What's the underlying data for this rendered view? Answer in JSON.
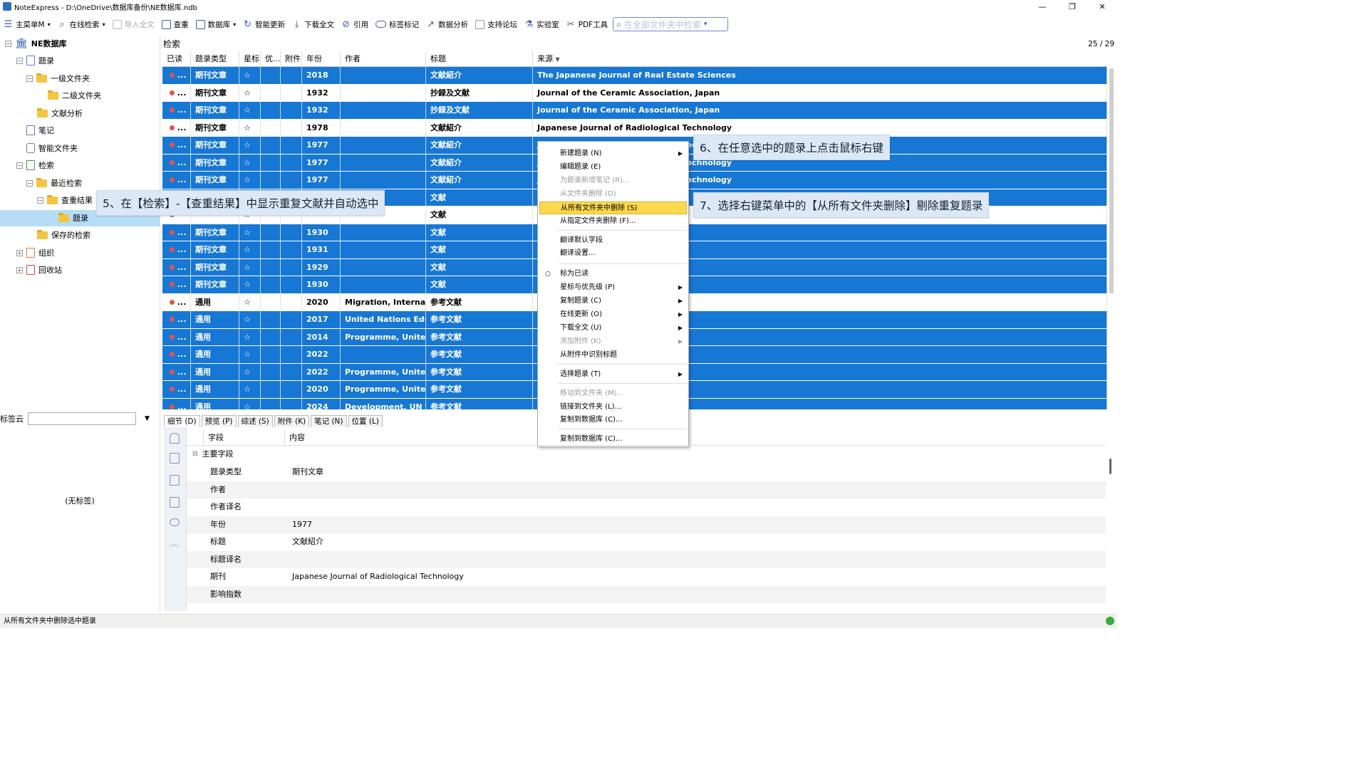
{
  "window": {
    "title": "NoteExpress - D:\\OneDrive\\数据库备份\\NE数据库.ndb",
    "minimize": "—",
    "maximize": "❐",
    "close": "✕"
  },
  "toolbar": {
    "items": [
      {
        "label": "主菜单M",
        "icon": "menu-icon",
        "dropdown": true
      },
      {
        "label": "在线检索",
        "icon": "search-icon",
        "dropdown": true
      },
      {
        "label": "导入全文",
        "icon": "import-icon",
        "disabled": true
      },
      {
        "label": "查重",
        "icon": "duplicate-icon"
      },
      {
        "label": "数据库",
        "icon": "database-icon",
        "dropdown": true
      },
      {
        "label": "智能更新",
        "icon": "refresh-icon"
      },
      {
        "label": "下载全文",
        "icon": "download-icon"
      },
      {
        "label": "引用",
        "icon": "cite-icon"
      },
      {
        "label": "标签标记",
        "icon": "tag-icon"
      },
      {
        "label": "数据分析",
        "icon": "chart-icon"
      },
      {
        "label": "支持论坛",
        "icon": "forum-icon"
      },
      {
        "label": "实验室",
        "icon": "lab-icon"
      },
      {
        "label": "PDF工具",
        "icon": "pdf-tool-icon"
      }
    ],
    "search_placeholder": "在全部文件夹中检索"
  },
  "tree": {
    "root": "NE数据库",
    "items": [
      {
        "label": "题录"
      },
      {
        "label": "一级文件夹"
      },
      {
        "label": "二级文件夹"
      },
      {
        "label": "文献分析"
      },
      {
        "label": "笔记"
      },
      {
        "label": "智能文件夹"
      },
      {
        "label": "检索"
      },
      {
        "label": "最近检索"
      },
      {
        "label": "查重结果"
      },
      {
        "label": "题录"
      },
      {
        "label": "保存的检索"
      },
      {
        "label": "组织"
      },
      {
        "label": "回收站"
      }
    ]
  },
  "main": {
    "heading": "检索",
    "page_counter": "25 / 29",
    "columns": [
      "已读",
      "题录类型",
      "星标",
      "优...",
      "附件",
      "年份",
      "作者",
      "标题",
      "来源"
    ],
    "rows": [
      {
        "sel": true,
        "more": "...",
        "type": "期刊文章",
        "year": "2018",
        "author": "",
        "title": "文献紹介",
        "source": "The Japanese Journal of Real Estate Sciences"
      },
      {
        "sel": false,
        "more": "...",
        "type": "期刊文章",
        "year": "1932",
        "author": "",
        "title": "抄録及文献",
        "source": "Journal of the Ceramic Association, Japan"
      },
      {
        "sel": true,
        "more": "...",
        "type": "期刊文章",
        "year": "1932",
        "author": "",
        "title": "抄録及文献",
        "source": "Journal of the Ceramic Association, Japan"
      },
      {
        "sel": false,
        "more": "...",
        "type": "期刊文章",
        "year": "1978",
        "author": "",
        "title": "文献紹介",
        "source": "Japanese Journal of Radiological Technology"
      },
      {
        "sel": true,
        "more": "...",
        "type": "期刊文章",
        "year": "1977",
        "author": "",
        "title": "文献紹介",
        "source": "Japanese Journal of Radiological Technology"
      },
      {
        "sel": true,
        "more": "...",
        "type": "期刊文章",
        "year": "1977",
        "author": "",
        "title": "文献紹介",
        "source": "Japanese Journal of Radiological Technology"
      },
      {
        "sel": true,
        "more": "...",
        "type": "期刊文章",
        "year": "1977",
        "author": "",
        "title": "文献紹介",
        "source": "Japanese Journal of Radiological Technology"
      },
      {
        "sel": true,
        "more": "",
        "type": "",
        "year": "",
        "author": "",
        "title": "文献",
        "source": ""
      },
      {
        "sel": false,
        "more": "",
        "type": "",
        "year": "",
        "author": "",
        "title": "文献",
        "source": ""
      },
      {
        "sel": true,
        "more": "...",
        "type": "期刊文章",
        "year": "1930",
        "author": "",
        "title": "文献",
        "source": ""
      },
      {
        "sel": true,
        "more": "...",
        "type": "期刊文章",
        "year": "1931",
        "author": "",
        "title": "文献",
        "source": ""
      },
      {
        "sel": true,
        "more": "...",
        "type": "期刊文章",
        "year": "1929",
        "author": "",
        "title": "文献",
        "source": ""
      },
      {
        "sel": true,
        "more": "...",
        "type": "期刊文章",
        "year": "1930",
        "author": "",
        "title": "文献",
        "source": ""
      },
      {
        "sel": false,
        "more": "...",
        "type": "通用",
        "year": "2020",
        "author": "Migration, Internati",
        "title": "参考文献",
        "source": ""
      },
      {
        "sel": true,
        "more": "...",
        "type": "通用",
        "year": "2017",
        "author": "United Nations Edu.",
        "title": "参考文献",
        "source": ""
      },
      {
        "sel": true,
        "more": "...",
        "type": "通用",
        "year": "2014",
        "author": "Programme, United",
        "title": "参考文献",
        "source": ""
      },
      {
        "sel": true,
        "more": "...",
        "type": "通用",
        "year": "2022",
        "author": "",
        "title": "参考文献",
        "source": ""
      },
      {
        "sel": true,
        "more": "...",
        "type": "通用",
        "year": "2022",
        "author": "Programme, United",
        "title": "参考文献",
        "source": ""
      },
      {
        "sel": true,
        "more": "...",
        "type": "通用",
        "year": "2020",
        "author": "Programme, United",
        "title": "参考文献",
        "source": ""
      },
      {
        "sel": true,
        "more": "...",
        "type": "通用",
        "year": "2024",
        "author": "Development, UN T",
        "title": "参考文献",
        "source": ""
      }
    ]
  },
  "context_menu": {
    "items": [
      {
        "label": "新建题录 (N)",
        "submenu": true,
        "disabled": false
      },
      {
        "label": "编辑题录 (E)",
        "submenu": false,
        "disabled": false
      },
      {
        "label": "为题录新增笔记 (R)...",
        "submenu": false,
        "disabled": true
      },
      {
        "label": "从文件夹删除 (D)",
        "submenu": false,
        "disabled": true
      },
      {
        "label": "从所有文件夹中删除 (S)",
        "submenu": false,
        "disabled": false,
        "highlight": true
      },
      {
        "label": "从指定文件夹删除 (F)...",
        "submenu": false,
        "disabled": false
      },
      {
        "label": "翻译默认字段",
        "submenu": false,
        "disabled": false
      },
      {
        "label": "翻译设置...",
        "submenu": false,
        "disabled": false
      },
      {
        "label": "标为已读",
        "submenu": false,
        "disabled": false,
        "radio": true
      },
      {
        "label": "星标与优先级 (P)",
        "submenu": true,
        "disabled": false
      },
      {
        "label": "复制题录 (C)",
        "submenu": true,
        "disabled": false
      },
      {
        "label": "在线更新 (O)",
        "submenu": true,
        "disabled": false
      },
      {
        "label": "下载全文 (U)",
        "submenu": true,
        "disabled": false
      },
      {
        "label": "添加附件 (K)",
        "submenu": true,
        "disabled": true
      },
      {
        "label": "从附件中识别标题",
        "submenu": false,
        "disabled": false
      },
      {
        "label": "选择题录 (T)",
        "submenu": true,
        "disabled": false
      },
      {
        "label": "移动到文件夹 (M)...",
        "submenu": false,
        "disabled": true
      },
      {
        "label": "链接到文件夹 (L)...",
        "submenu": false,
        "disabled": false
      },
      {
        "label": "复制到数据库 (C)...",
        "submenu": false,
        "disabled": false
      },
      {
        "label": "复制到数据库 (C)...",
        "submenu": false,
        "disabled": false
      }
    ]
  },
  "callouts": {
    "step5": "5、在【检索】-【查重结果】中显示重复文献并自动选中",
    "step6": "6、在任意选中的题录上点击鼠标右键",
    "step7": "7、选择右键菜单中的【从所有文件夹删除】剔除重复题录"
  },
  "tagcloud": {
    "label": "标签云",
    "empty": "(无标签)"
  },
  "detail": {
    "tabs": [
      "细节 (D)",
      "预览 (P)",
      "综述 (S)",
      "附件 (K)",
      "笔记 (N)",
      "位置 (L)"
    ],
    "col_field": "字段",
    "col_content": "内容",
    "group": "主要字段",
    "fields": [
      {
        "k": "题录类型",
        "v": "期刊文章"
      },
      {
        "k": "作者",
        "v": ""
      },
      {
        "k": "作者译名",
        "v": ""
      },
      {
        "k": "年份",
        "v": "1977"
      },
      {
        "k": "标题",
        "v": "文献紹介"
      },
      {
        "k": "标题译名",
        "v": ""
      },
      {
        "k": "期刊",
        "v": "Japanese Journal of Radiological Technology"
      },
      {
        "k": "影响指数",
        "v": ""
      }
    ]
  },
  "status": {
    "text": "从所有文件夹中删除选中题录"
  },
  "colors": {
    "selection": "#1777d4",
    "menu_highlight": "#fbd84d",
    "callout_bg": "#dde8f6"
  }
}
